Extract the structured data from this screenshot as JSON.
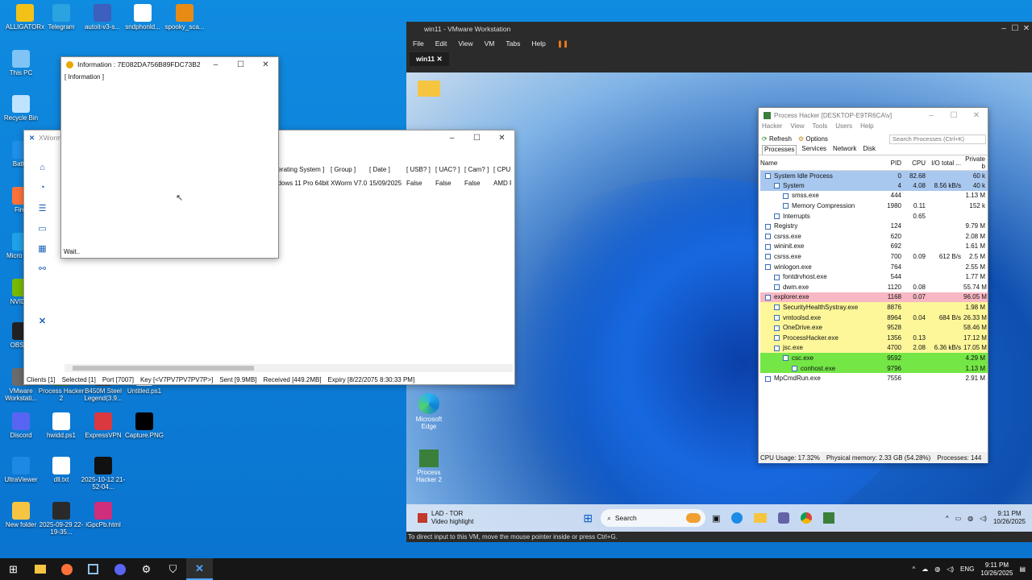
{
  "desktop_icons": [
    {
      "label": "ALLIGATORx",
      "color": "#f3c218"
    },
    {
      "label": "Telegram",
      "color": "#2aa3e0"
    },
    {
      "label": "autoit-v3-s...",
      "color": "#3d5fbd"
    },
    {
      "label": "sndphonld...",
      "color": "#ffffff"
    },
    {
      "label": "spooky_sca...",
      "color": "#e88b14"
    },
    {
      "label": "This PC",
      "color": "#7fc4f5"
    },
    {
      "label": "Recycle Bin",
      "color": "#bfe3ff"
    },
    {
      "label": "Battle",
      "color": "#1f8fe8"
    },
    {
      "label": "Firef",
      "color": "#ff7139"
    },
    {
      "label": "Micro Edg",
      "color": "#1fa1e8"
    },
    {
      "label": "NVIDIA",
      "color": "#76b900"
    },
    {
      "label": "OBS St",
      "color": "#222222"
    },
    {
      "label": "VMware Workstati...",
      "color": "#6b6b6b"
    },
    {
      "label": "Process Hacker 2",
      "color": "#3a7f3a"
    },
    {
      "label": "B450M Steel Legend(3.9...",
      "color": "#444444"
    },
    {
      "label": "Untitled.ps1",
      "color": "#ffffff"
    },
    {
      "label": "Discord",
      "color": "#5865f2"
    },
    {
      "label": "hwidd.ps1",
      "color": "#ffffff"
    },
    {
      "label": "ExpressVPN",
      "color": "#da3940"
    },
    {
      "label": "Capture.PNG",
      "color": "#000000"
    },
    {
      "label": "UltraViewer",
      "color": "#1e88e5"
    },
    {
      "label": "dll.txt",
      "color": "#ffffff"
    },
    {
      "label": "2025-10-12 21-52-04...",
      "color": "#111111"
    },
    {
      "label": "New folder",
      "color": "#f5c542"
    },
    {
      "label": "2025-09-29 22-19-35...",
      "color": "#2a2a2a"
    },
    {
      "label": "iGpcPb.html",
      "color": "#cf2e7d"
    }
  ],
  "info_window": {
    "title": "Information : 7E082DA756B89FDC73B2",
    "header": "[ Information ]",
    "footer": "Wait.."
  },
  "xworm": {
    "title": "XWorm",
    "columns": [
      "perating System ]",
      "[ Group ]",
      "[ Date ]",
      "[ USB? ]",
      "[ UAC? ]",
      "[ Cam? ]",
      "[ CPU"
    ],
    "row": [
      "ndows 11 Pro 64bit",
      "XWorm V7.0",
      "15/09/2025",
      "False",
      "False",
      "False",
      "AMD R"
    ],
    "status": [
      "Clients [1]",
      "Selected [1]",
      "Port [7007]",
      "Key [<V7PV7PV7PV7P>]",
      "Sent [9.9MB]",
      "Received [449.2MB]",
      "Expiry [8/22/2075 8:30:33 PM]"
    ]
  },
  "vmware": {
    "title": "win11 - VMware Workstation",
    "menu": [
      "File",
      "Edit",
      "View",
      "VM",
      "Tabs",
      "Help"
    ],
    "tab": "win11",
    "status": "To direct input to this VM, move the mouse pointer inside or press Ctrl+G.",
    "guest_icons": [
      "Microsoft Edge",
      "Process Hacker 2"
    ],
    "guest_taskbar": {
      "weather_title": "LAD - TOR",
      "weather_sub": "Video highlight",
      "search": "Search",
      "lang": "ENG",
      "time": "9:11 PM",
      "date": "10/26/2025"
    }
  },
  "process_hacker": {
    "title": "Process Hacker [DESKTOP-E9TR6CA\\v]",
    "menu": [
      "Hacker",
      "View",
      "Tools",
      "Users",
      "Help"
    ],
    "refresh": "Refresh",
    "options": "Options",
    "search_placeholder": "Search Processes (Ctrl+K)",
    "tabs": [
      "Processes",
      "Services",
      "Network",
      "Disk"
    ],
    "columns": [
      "Name",
      "PID",
      "CPU",
      "I/O total ...",
      "Private b"
    ],
    "rows": [
      {
        "name": "System Idle Process",
        "pid": "0",
        "cpu": "82.68",
        "io": "",
        "priv": "60 k",
        "bg": "#a9c8f0",
        "indent": 0
      },
      {
        "name": "System",
        "pid": "4",
        "cpu": "4.08",
        "io": "8.56 kB/s",
        "priv": "40 k",
        "bg": "#a9c8f0",
        "indent": 1
      },
      {
        "name": "smss.exe",
        "pid": "444",
        "cpu": "",
        "io": "",
        "priv": "1.13 M",
        "bg": "",
        "indent": 2
      },
      {
        "name": "Memory Compression",
        "pid": "1980",
        "cpu": "0.11",
        "io": "",
        "priv": "152 k",
        "bg": "",
        "indent": 2
      },
      {
        "name": "Interrupts",
        "pid": "",
        "cpu": "0.65",
        "io": "",
        "priv": "",
        "bg": "",
        "indent": 1
      },
      {
        "name": "Registry",
        "pid": "124",
        "cpu": "",
        "io": "",
        "priv": "9.79 M",
        "bg": "",
        "indent": 0
      },
      {
        "name": "csrss.exe",
        "pid": "620",
        "cpu": "",
        "io": "",
        "priv": "2.08 M",
        "bg": "",
        "indent": 0
      },
      {
        "name": "wininit.exe",
        "pid": "692",
        "cpu": "",
        "io": "",
        "priv": "1.61 M",
        "bg": "",
        "indent": 0
      },
      {
        "name": "csrss.exe",
        "pid": "700",
        "cpu": "0.09",
        "io": "612 B/s",
        "priv": "2.5 M",
        "bg": "",
        "indent": 0
      },
      {
        "name": "winlogon.exe",
        "pid": "764",
        "cpu": "",
        "io": "",
        "priv": "2.55 M",
        "bg": "",
        "indent": 0
      },
      {
        "name": "fontdrvhost.exe",
        "pid": "544",
        "cpu": "",
        "io": "",
        "priv": "1.77 M",
        "bg": "",
        "indent": 1
      },
      {
        "name": "dwm.exe",
        "pid": "1120",
        "cpu": "0.08",
        "io": "",
        "priv": "55.74 M",
        "bg": "",
        "indent": 1
      },
      {
        "name": "explorer.exe",
        "pid": "1168",
        "cpu": "0.07",
        "io": "",
        "priv": "96.05 M",
        "bg": "#f7b7c3",
        "indent": 0
      },
      {
        "name": "SecurityHealthSystray.exe",
        "pid": "8876",
        "cpu": "",
        "io": "",
        "priv": "1.98 M",
        "bg": "#fdf79a",
        "indent": 1
      },
      {
        "name": "vmtoolsd.exe",
        "pid": "8964",
        "cpu": "0.04",
        "io": "684 B/s",
        "priv": "26.33 M",
        "bg": "#fdf79a",
        "indent": 1
      },
      {
        "name": "OneDrive.exe",
        "pid": "9528",
        "cpu": "",
        "io": "",
        "priv": "58.46 M",
        "bg": "#fdf79a",
        "indent": 1
      },
      {
        "name": "ProcessHacker.exe",
        "pid": "1356",
        "cpu": "0.13",
        "io": "",
        "priv": "17.12 M",
        "bg": "#fdf79a",
        "indent": 1
      },
      {
        "name": "jsc.exe",
        "pid": "4700",
        "cpu": "2.08",
        "io": "6.36 kB/s",
        "priv": "17.05 M",
        "bg": "#fdf79a",
        "indent": 1
      },
      {
        "name": "csc.exe",
        "pid": "9592",
        "cpu": "",
        "io": "",
        "priv": "4.29 M",
        "bg": "#74e646",
        "indent": 2
      },
      {
        "name": "conhost.exe",
        "pid": "9796",
        "cpu": "",
        "io": "",
        "priv": "1.13 M",
        "bg": "#74e646",
        "indent": 3
      },
      {
        "name": "MpCmdRun.exe",
        "pid": "7556",
        "cpu": "",
        "io": "",
        "priv": "2.91 M",
        "bg": "",
        "indent": 0
      }
    ],
    "status": [
      "CPU Usage: 17.32%",
      "Physical memory: 2.33 GB (54.28%)",
      "Processes: 144"
    ]
  },
  "taskbar": {
    "lang": "ENG",
    "time": "9:11 PM",
    "date": "10/26/2025"
  }
}
